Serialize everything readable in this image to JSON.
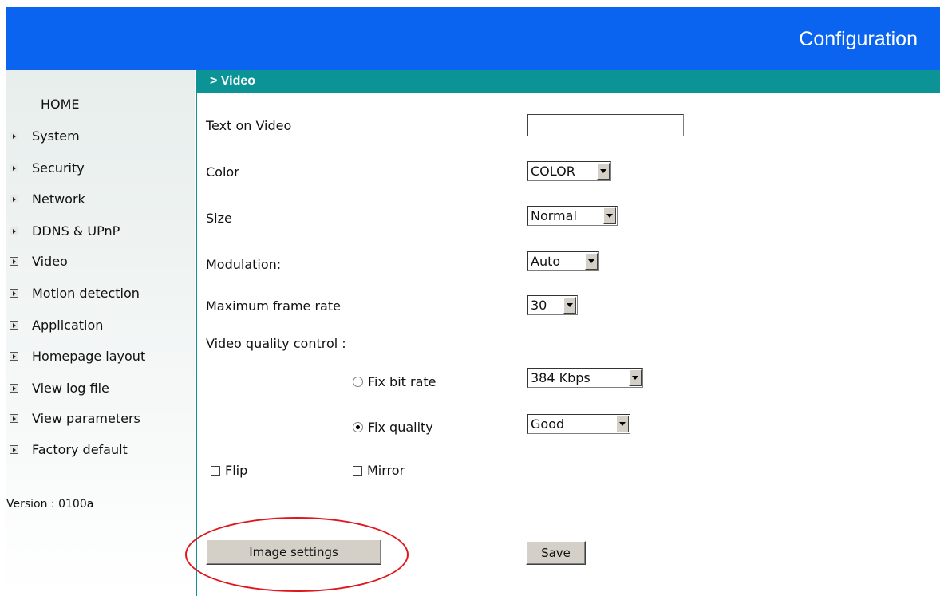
{
  "header": {
    "title": "Configuration"
  },
  "sidebar": {
    "home": "HOME",
    "items": [
      {
        "label": "System"
      },
      {
        "label": "Security"
      },
      {
        "label": "Network"
      },
      {
        "label": "DDNS & UPnP"
      },
      {
        "label": "Video"
      },
      {
        "label": "Motion detection"
      },
      {
        "label": "Application"
      },
      {
        "label": "Homepage layout"
      },
      {
        "label": "View log file"
      },
      {
        "label": "View parameters"
      },
      {
        "label": "Factory default"
      }
    ],
    "item_icon": "arrow-right-icon",
    "version": "Version : 0100a"
  },
  "section": {
    "title": "> Video"
  },
  "form": {
    "text_on_video": {
      "label": "Text on Video",
      "value": ""
    },
    "color": {
      "label": "Color",
      "value": "COLOR"
    },
    "size": {
      "label": "Size",
      "value": "Normal"
    },
    "modulation": {
      "label": "Modulation:",
      "value": "Auto"
    },
    "max_frame_rate": {
      "label": "Maximum frame rate",
      "value": "30"
    },
    "quality_control": {
      "label": "Video quality control :"
    },
    "fix_bit_rate": {
      "label": "Fix bit rate",
      "checked": false,
      "value": "384 Kbps"
    },
    "fix_quality": {
      "label": "Fix quality",
      "checked": true,
      "value": "Good"
    },
    "flip": {
      "label": "Flip",
      "checked": false
    },
    "mirror": {
      "label": "Mirror",
      "checked": false
    }
  },
  "buttons": {
    "image_settings": "Image settings",
    "save": "Save"
  },
  "colors": {
    "header_blue": "#0a64f0",
    "section_teal": "#0c9396",
    "highlight_red": "#e0161c"
  }
}
